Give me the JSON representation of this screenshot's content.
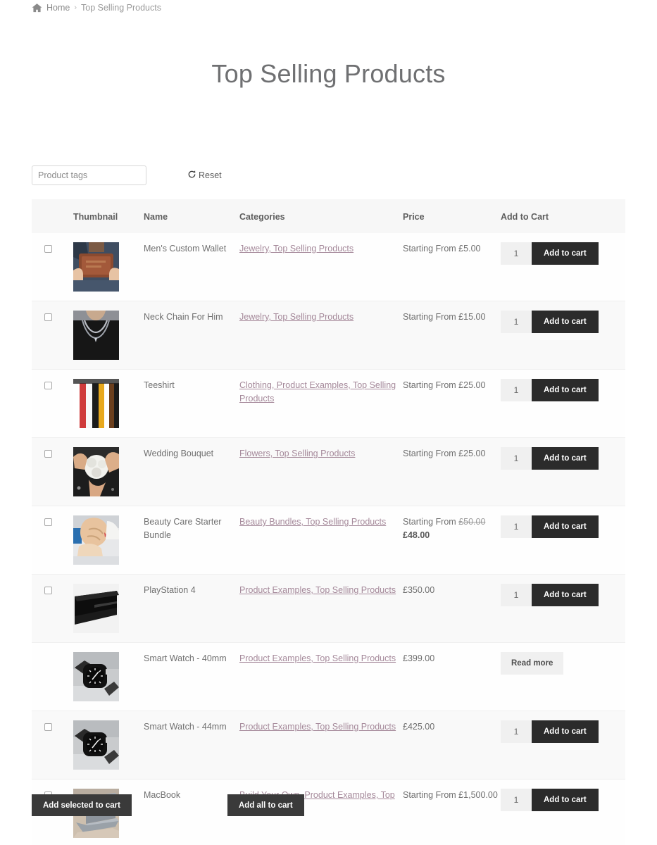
{
  "breadcrumb": {
    "home_icon": "home-icon",
    "home_label": "Home",
    "separator": "›",
    "current": "Top Selling Products"
  },
  "page_title": "Top Selling Products",
  "filter": {
    "tag_placeholder": "Product tags",
    "tag_value": "",
    "reset_label": "Reset",
    "reset_icon": "refresh-icon"
  },
  "table": {
    "headers": {
      "select": "",
      "thumbnail": "Thumbnail",
      "name": "Name",
      "categories": "Categories",
      "price": "Price",
      "cart": "Add to Cart"
    },
    "rows": [
      {
        "name": "Men's Custom Wallet",
        "categories": "Jewelry, Top Selling Products",
        "price": "Starting From £5.00",
        "price_old": "",
        "price_new": "",
        "qty": "1",
        "action": "Add to cart",
        "action_type": "add",
        "has_checkbox": true,
        "thumb": "wallet"
      },
      {
        "name": "Neck Chain For Him",
        "categories": "Jewelry, Top Selling Products",
        "price": "Starting From £15.00",
        "price_old": "",
        "price_new": "",
        "qty": "1",
        "action": "Add to cart",
        "action_type": "add",
        "has_checkbox": true,
        "thumb": "necklace"
      },
      {
        "name": "Teeshirt",
        "categories": "Clothing, Product Examples, Top Selling Products",
        "price": "Starting From £25.00",
        "price_old": "",
        "price_new": "",
        "qty": "1",
        "action": "Add to cart",
        "action_type": "add",
        "has_checkbox": true,
        "thumb": "teeshirt"
      },
      {
        "name": "Wedding Bouquet",
        "categories": "Flowers, Top Selling Products",
        "price": "Starting From £25.00",
        "price_old": "",
        "price_new": "",
        "qty": "1",
        "action": "Add to cart",
        "action_type": "add",
        "has_checkbox": true,
        "thumb": "bouquet"
      },
      {
        "name": "Beauty Care Starter Bundle",
        "categories": "Beauty Bundles, Top Selling Products",
        "price": "Starting From ",
        "price_old": "£50.00",
        "price_new": "£48.00",
        "qty": "1",
        "action": "Add to cart",
        "action_type": "add",
        "has_checkbox": true,
        "thumb": "beauty"
      },
      {
        "name": "PlayStation 4",
        "categories": "Product Examples, Top Selling Products",
        "price": "£350.00",
        "price_old": "",
        "price_new": "",
        "qty": "1",
        "action": "Add to cart",
        "action_type": "add",
        "has_checkbox": true,
        "thumb": "playstation"
      },
      {
        "name": "Smart Watch - 40mm",
        "categories": "Product Examples, Top Selling Products",
        "price": "£399.00",
        "price_old": "",
        "price_new": "",
        "qty": "",
        "action": "Read more",
        "action_type": "read",
        "has_checkbox": false,
        "thumb": "watch"
      },
      {
        "name": "Smart Watch - 44mm",
        "categories": "Product Examples, Top Selling Products",
        "price": "£425.00",
        "price_old": "",
        "price_new": "",
        "qty": "1",
        "action": "Add to cart",
        "action_type": "add",
        "has_checkbox": true,
        "thumb": "watch"
      },
      {
        "name": "MacBook",
        "categories": "Build Your Own, Product Examples, Top Selling Products",
        "price": "Starting From £1,500.00",
        "price_old": "",
        "price_new": "",
        "qty": "1",
        "action": "Add to cart",
        "action_type": "add",
        "has_checkbox": true,
        "thumb": "macbook"
      }
    ]
  },
  "footer": {
    "add_selected_label": "Add selected to cart",
    "add_all_label": "Add all to cart"
  },
  "colors": {
    "category_link": "#a5899a",
    "button_dark": "#2b2b2b",
    "bulk_button": "#3a3a3a",
    "header_bg": "#f7f7f7",
    "row_alt_bg": "#f9f9f9",
    "text": "#6f6f6f",
    "title": "#6f7072"
  }
}
